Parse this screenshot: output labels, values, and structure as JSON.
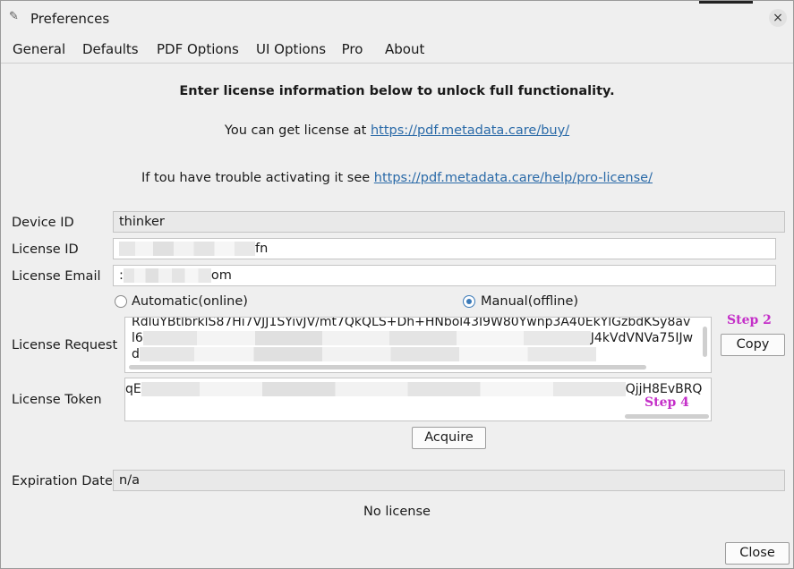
{
  "window": {
    "title": "Preferences",
    "icon": "app-feather-icon",
    "close_glyph": "×"
  },
  "tabs": [
    {
      "label": "General"
    },
    {
      "label": "Defaults"
    },
    {
      "label": "PDF Options"
    },
    {
      "label": "UI Options"
    },
    {
      "label": "Pro",
      "active": true
    },
    {
      "label": "About"
    }
  ],
  "intro": {
    "heading": "Enter license information below to unlock full functionality.",
    "buy_prefix": "You can get license at ",
    "buy_link": "https://pdf.metadata.care/buy/",
    "help_prefix": "If tou have trouble activating it see ",
    "help_link": "https://pdf.metadata.care/help/pro-license/"
  },
  "fields": {
    "device_id": {
      "label": "Device ID",
      "value": "thinker"
    },
    "license_id": {
      "label": "License ID",
      "value_suffix": "fn"
    },
    "license_email": {
      "label": "License Email",
      "value_prefix": ":",
      "value_suffix": "om"
    }
  },
  "activation": {
    "automatic_label": "Automatic(online)",
    "manual_label": "Manual(offline)",
    "selected": "manual"
  },
  "license_request": {
    "label": "License Request",
    "line1": "RdluYBtlbrklS87Hi7VJJ1SYivJV/mt7QkQLS+Dh+HNbol43I9W80Ywnp3A40EkYlGzbdKSy8av",
    "line2_prefix": "l6",
    "line2_suffix": "J4kVdVNVa75IJw",
    "line3_prefix": "d",
    "copy_label": "Copy",
    "step_label": "Step 2"
  },
  "license_token": {
    "label": "License Token",
    "value_prefix": "qE",
    "value_suffix": "QjjH8EvBRQ",
    "step_label": "Step 4"
  },
  "acquire_label": "Acquire",
  "expiration": {
    "label": "Expiration Date",
    "value": "n/a"
  },
  "status_text": "No license",
  "close_label": "Close"
}
